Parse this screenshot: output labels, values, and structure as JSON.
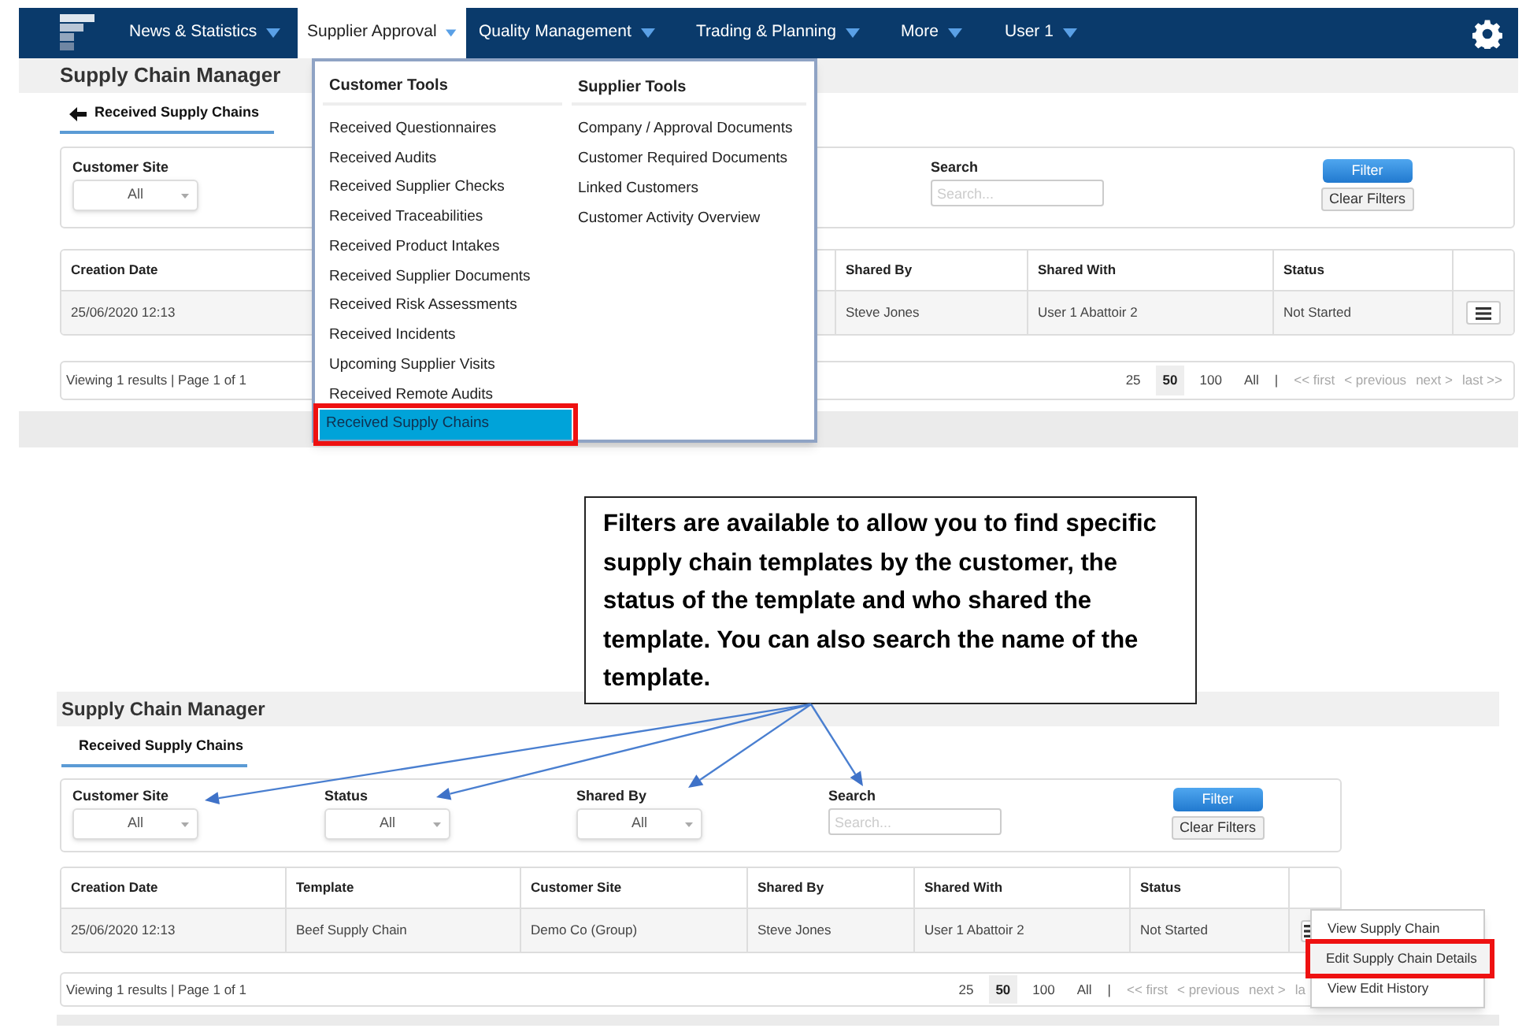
{
  "top_screen": {
    "nav": [
      {
        "label": "News & Statistics",
        "selected": false
      },
      {
        "label": "Supplier Approval",
        "selected": true
      },
      {
        "label": "Quality Management",
        "selected": false
      },
      {
        "label": "Trading & Planning",
        "selected": false
      },
      {
        "label": "More",
        "selected": false
      },
      {
        "label": "User 1",
        "selected": false
      }
    ],
    "page_title": "Supply Chain Manager",
    "tab": {
      "label": "Received Supply Chains",
      "selected": true
    },
    "filters": [
      {
        "kind": "select",
        "label": "Customer Site",
        "value": "All"
      },
      {
        "kind": "search",
        "label": "Search",
        "placeholder": "Search..."
      }
    ],
    "buttons": [
      "Filter",
      "Clear Filters"
    ],
    "table": {
      "columns": [
        "Creation Date",
        "Shared By",
        "Shared With",
        "Status"
      ],
      "rows": [
        [
          "25/06/2020 12:13",
          "Steve Jones",
          "User 1 Abattoir 2",
          "Not Started"
        ]
      ]
    },
    "pagination": {
      "summary": "Viewing 1 results | Page 1 of 1",
      "page_sizes": [
        {
          "label": "25",
          "selected": false
        },
        {
          "label": "50",
          "selected": true
        },
        {
          "label": "100",
          "selected": false
        },
        {
          "label": "All",
          "selected": false
        }
      ],
      "separator": "|",
      "links": [
        {
          "label": "<< first",
          "disabled": true
        },
        {
          "label": "< previous",
          "disabled": true
        },
        {
          "label": "next >",
          "disabled": true
        },
        {
          "label": "last >>",
          "disabled": true
        }
      ]
    },
    "dropdown": {
      "columns": [
        {
          "heading": "Customer Tools",
          "items": [
            {
              "label": "Received Questionnaires",
              "selected": false,
              "annotated": false
            },
            {
              "label": "Received Audits",
              "selected": false,
              "annotated": false
            },
            {
              "label": "Received Supplier Checks",
              "selected": false,
              "annotated": false
            },
            {
              "label": "Received Traceabilities",
              "selected": false,
              "annotated": false
            },
            {
              "label": "Received Product Intakes",
              "selected": false,
              "annotated": false
            },
            {
              "label": "Received Supplier Documents",
              "selected": false,
              "annotated": false
            },
            {
              "label": "Received Risk Assessments",
              "selected": false,
              "annotated": false
            },
            {
              "label": "Received Incidents",
              "selected": false,
              "annotated": false
            },
            {
              "label": "Upcoming Supplier Visits",
              "selected": false,
              "annotated": false
            },
            {
              "label": "Received Remote Audits",
              "selected": false,
              "annotated": false
            },
            {
              "label": "Received Supply Chains",
              "selected": true,
              "annotated": true
            }
          ]
        },
        {
          "heading": "Supplier Tools",
          "items": [
            {
              "label": "Company / Approval Documents",
              "selected": false,
              "annotated": false
            },
            {
              "label": "Customer Required Documents",
              "selected": false,
              "annotated": false
            },
            {
              "label": "Linked Customers",
              "selected": false,
              "annotated": false
            },
            {
              "label": "Customer Activity Overview",
              "selected": false,
              "annotated": false
            }
          ]
        }
      ]
    }
  },
  "callout": "Filters are available to allow you to find specific supply chain templates by the customer, the status of the template and who shared the template. You can also search the name of the template.",
  "bottom_screen": {
    "page_title": "Supply Chain Manager",
    "tab": {
      "label": "Received Supply Chains",
      "selected": true
    },
    "filters": [
      {
        "kind": "select",
        "label": "Customer Site",
        "value": "All"
      },
      {
        "kind": "select",
        "label": "Status",
        "value": "All"
      },
      {
        "kind": "select",
        "label": "Shared By",
        "value": "All"
      },
      {
        "kind": "search",
        "label": "Search",
        "placeholder": "Search..."
      }
    ],
    "buttons": [
      "Filter",
      "Clear Filters"
    ],
    "table": {
      "columns": [
        "Creation Date",
        "Template",
        "Customer Site",
        "Shared By",
        "Shared With",
        "Status"
      ],
      "rows": [
        [
          "25/06/2020 12:13",
          "Beef Supply Chain",
          "Demo Co (Group)",
          "Steve Jones",
          "User 1 Abattoir 2",
          "Not Started"
        ]
      ]
    },
    "pagination": {
      "summary": "Viewing 1 results | Page 1 of 1",
      "page_sizes": [
        {
          "label": "25",
          "selected": false
        },
        {
          "label": "50",
          "selected": true
        },
        {
          "label": "100",
          "selected": false
        },
        {
          "label": "All",
          "selected": false
        }
      ],
      "separator": "|",
      "links": [
        {
          "label": "<< first",
          "disabled": true
        },
        {
          "label": "< previous",
          "disabled": true
        },
        {
          "label": "next >",
          "disabled": true
        },
        {
          "label": "la",
          "disabled": true
        }
      ]
    },
    "context_menu": [
      {
        "label": "View Supply Chain",
        "annotated": false
      },
      {
        "label": "Edit Supply Chain Details",
        "annotated": true
      },
      {
        "label": "View Edit History",
        "annotated": false
      }
    ]
  }
}
